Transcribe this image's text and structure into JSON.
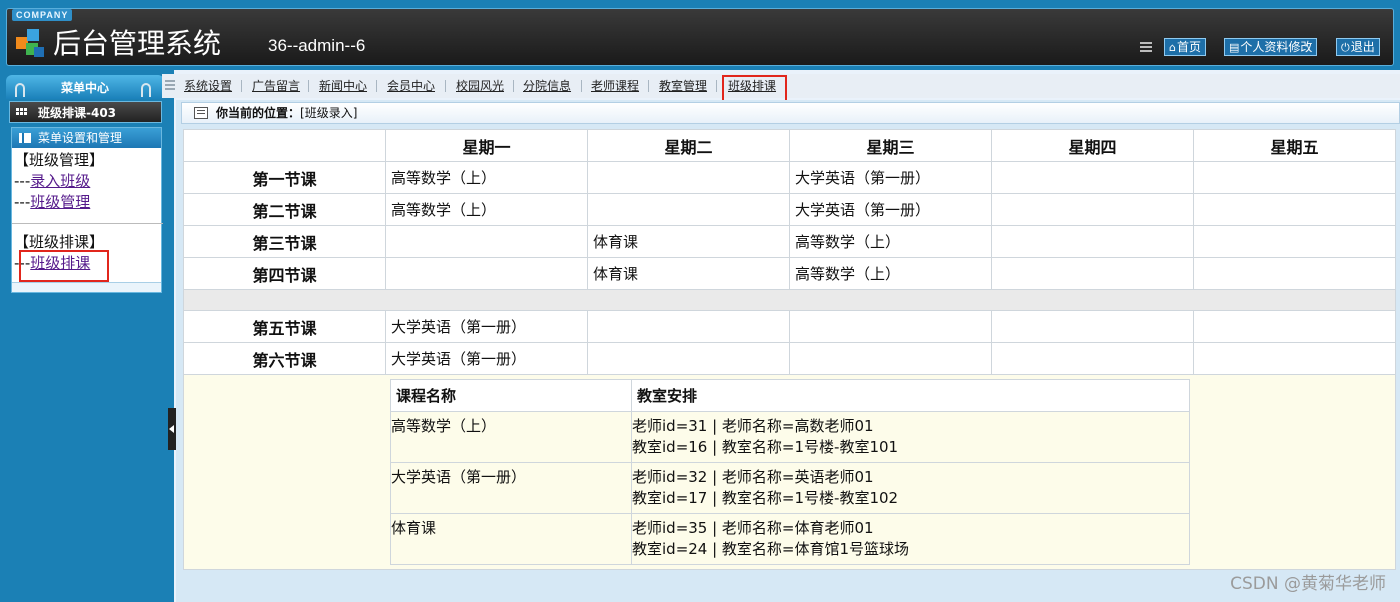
{
  "header": {
    "company": "COMPANY",
    "title": "后台管理系统",
    "user": "36--admin--6",
    "buttons": {
      "home": "首页",
      "profile": "个人资料修改",
      "logout": "退出"
    }
  },
  "sidebar": {
    "menu_center": "菜单中心",
    "current_item": "班级排课-403",
    "panel_title": "菜单设置和管理",
    "groups": [
      {
        "title": "【班级管理】",
        "links": [
          {
            "prefix": "---",
            "label": "录入班级"
          },
          {
            "prefix": "---",
            "label": "班级管理"
          }
        ]
      },
      {
        "title": "【班级排课】",
        "links": [
          {
            "prefix": "---",
            "label": "班级排课"
          }
        ]
      }
    ]
  },
  "nav": {
    "items": [
      "系统设置",
      "广告留言",
      "新闻中心",
      "会员中心",
      "校园风光",
      "分院信息",
      "老师课程",
      "教室管理",
      "班级排课"
    ],
    "active_index": 8
  },
  "breadcrumb": {
    "label": "你当前的位置：",
    "value": "[班级录入]"
  },
  "schedule": {
    "days": [
      "星期一",
      "星期二",
      "星期三",
      "星期四",
      "星期五"
    ],
    "rows": [
      {
        "period": "第一节课",
        "cells": [
          "高等数学（上）",
          "",
          "大学英语（第一册）",
          "",
          ""
        ]
      },
      {
        "period": "第二节课",
        "cells": [
          "高等数学（上）",
          "",
          "大学英语（第一册）",
          "",
          ""
        ]
      },
      {
        "period": "第三节课",
        "cells": [
          "",
          "体育课",
          "高等数学（上）",
          "",
          ""
        ]
      },
      {
        "period": "第四节课",
        "cells": [
          "",
          "体育课",
          "高等数学（上）",
          "",
          ""
        ]
      },
      {
        "period": "第五节课",
        "cells": [
          "大学英语（第一册）",
          "",
          "",
          "",
          ""
        ]
      },
      {
        "period": "第六节课",
        "cells": [
          "大学英语（第一册）",
          "",
          "",
          "",
          ""
        ]
      }
    ]
  },
  "course_legend": {
    "headers": [
      "课程名称",
      "教室安排"
    ],
    "rows": [
      {
        "course": "高等数学（上）",
        "teacher": "老师id=31 | 老师名称=高数老师01",
        "room": "教室id=16 | 教室名称=1号楼-教室101"
      },
      {
        "course": "大学英语（第一册）",
        "teacher": "老师id=32 | 老师名称=英语老师01",
        "room": "教室id=17 | 教室名称=1号楼-教室102"
      },
      {
        "course": "体育课",
        "teacher": "老师id=35 | 老师名称=体育老师01",
        "room": "教室id=24 | 教室名称=体育馆1号篮球场"
      }
    ]
  },
  "watermark": "CSDN @黄菊华老师",
  "colors": {
    "accent": "#1b80b5",
    "highlight": "#e1261c",
    "legend_bg": "#fdfcea"
  },
  "icons": [
    "cube-logo-icon",
    "menu-lines-icon",
    "home-icon",
    "profile-icon",
    "power-icon",
    "grid-icon",
    "panel-icon",
    "breadcrumb-icon",
    "collapse-arrow-icon"
  ]
}
